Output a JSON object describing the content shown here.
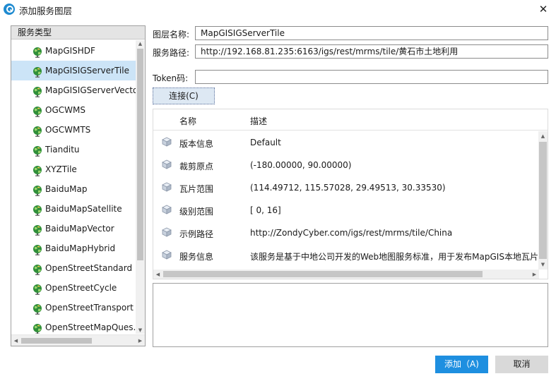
{
  "window": {
    "title": "添加服务图层",
    "close": "✕"
  },
  "left": {
    "header": "服务类型",
    "items": [
      {
        "label": "MapGISHDF"
      },
      {
        "label": "MapGISIGServerTile"
      },
      {
        "label": "MapGISIGServerVector"
      },
      {
        "label": "OGCWMS"
      },
      {
        "label": "OGCWMTS"
      },
      {
        "label": "Tianditu"
      },
      {
        "label": "XYZTile"
      },
      {
        "label": "BaiduMap"
      },
      {
        "label": "BaiduMapSatellite"
      },
      {
        "label": "BaiduMapVector"
      },
      {
        "label": "BaiduMapHybrid"
      },
      {
        "label": "OpenStreetStandard"
      },
      {
        "label": "OpenStreetCycle"
      },
      {
        "label": "OpenStreetTransport"
      },
      {
        "label": "OpenStreetMapQues..."
      }
    ],
    "selected_index": 1
  },
  "form": {
    "layer_name_label": "图层名称:",
    "layer_name_value": "MapGISIGServerTile",
    "service_path_label": "服务路径:",
    "service_path_value": "http://192.168.81.235:6163/igs/rest/mrms/tile/黄石市土地利用",
    "token_label": "Token码:",
    "token_value": "",
    "connect_label": "连接(C)"
  },
  "props": {
    "col_name": "名称",
    "col_desc": "描述",
    "rows": [
      {
        "name": "版本信息",
        "desc": "Default"
      },
      {
        "name": "裁剪原点",
        "desc": "(-180.00000, 90.00000)"
      },
      {
        "name": "瓦片范围",
        "desc": "(114.49712, 115.57028, 29.49513, 30.33530)"
      },
      {
        "name": "级别范围",
        "desc": "[ 0, 16]"
      },
      {
        "name": "示例路径",
        "desc": "http://ZondyCyber.com/igs/rest/mrms/tile/China"
      },
      {
        "name": "服务信息",
        "desc": "该服务是基于中地公司开发的Web地图服务标准，用于发布MapGIS本地瓦片数"
      }
    ]
  },
  "buttons": {
    "add": "添加（A)",
    "cancel": "取消"
  },
  "colors": {
    "accent": "#1e8fe0",
    "selection": "#cce4f7"
  }
}
